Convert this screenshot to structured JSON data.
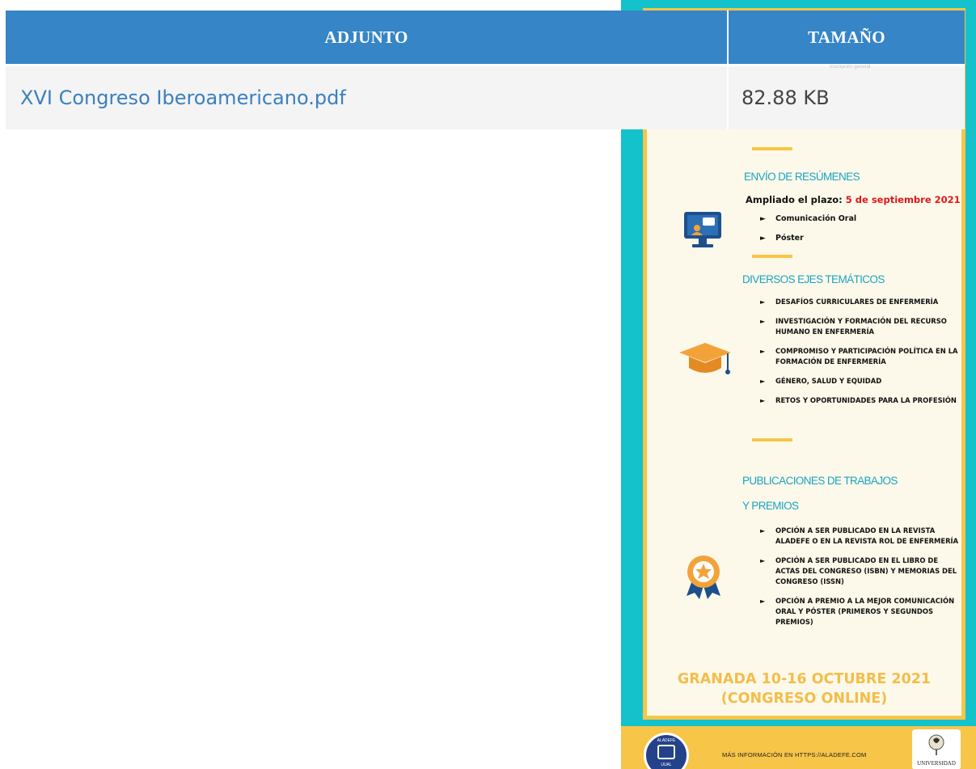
{
  "table": {
    "headers": {
      "attachment": "ADJUNTO",
      "size": "TAMAÑO"
    },
    "rows": [
      {
        "file_name": "XVI Congreso Iberoamericano.pdf",
        "size": "82.88 KB"
      }
    ]
  },
  "poster": {
    "behind_header_note": "Inscripción general",
    "section_abstracts": {
      "title": "ENVÍO DE RESÚMENES",
      "deadline_label": "Ampliado el plazo:",
      "deadline_value": "5 de septiembre 2021",
      "items": [
        "Comunicación Oral",
        "Póster"
      ]
    },
    "section_themes": {
      "title": "DIVERSOS EJES TEMÁTICOS",
      "items": [
        "DESAFÍOS CURRICULARES DE ENFERMERÍA",
        "INVESTIGACIÓN Y FORMACIÓN DEL RECURSO HUMANO EN ENFERMERÍA",
        "COMPROMISO Y PARTICIPACIÓN POLÍTICA EN LA FORMACIÓN DE ENFERMERÍA",
        "GÉNERO, SALUD Y EQUIDAD",
        "RETOS Y OPORTUNIDADES PARA LA PROFESIÓN"
      ]
    },
    "section_publications": {
      "title_line1": "PUBLICACIONES DE TRABAJOS",
      "title_line2": "Y PREMIOS",
      "items": [
        "OPCIÓN A SER PUBLICADO EN LA REVISTA ALADEFE O EN LA REVISTA ROL DE ENFERMERÍA",
        "OPCIÓN A SER PUBLICADO EN EL LIBRO DE ACTAS DEL CONGRESO (ISBN) Y MEMORIAS DEL CONGRESO (ISSN)",
        "OPCIÓN A PREMIO A LA MEJOR COMUNICACIÓN ORAL Y PÓSTER (PRIMEROS Y SEGUNDOS PREMIOS)"
      ]
    },
    "event_line1": "GRANADA 10-16 OCTUBRE 2021",
    "event_line2": "(CONGRESO ONLINE)",
    "footer_text": "MÁS INFORMACIÓN EN HTTPS://ALADEFE.COM",
    "logo_left_text": "ALADEFE",
    "logo_left_sub": "UUAL",
    "logo_right_text": "UNIVERSIDAD"
  },
  "colors": {
    "header_bg": "#3685c6",
    "row_bg": "#f4f4f4",
    "link": "#3a80c0",
    "poster_teal": "#14c2cc",
    "poster_yellow": "#f7c548",
    "poster_cream": "#fdf9ea",
    "section_title": "#19a4c0",
    "deadline_red": "#e01818"
  }
}
